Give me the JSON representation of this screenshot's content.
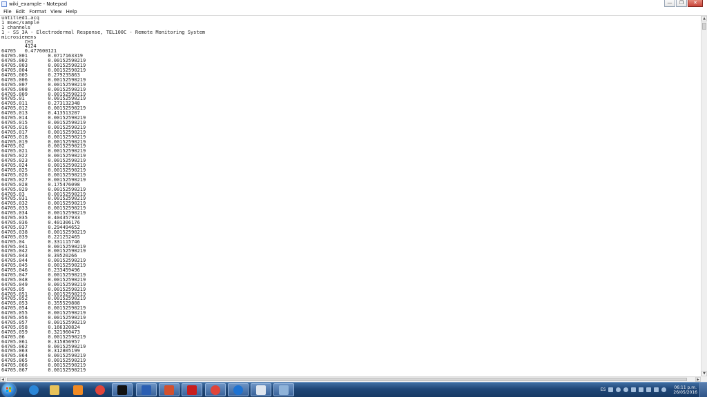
{
  "window": {
    "title": "wiki_example - Notepad",
    "controls": {
      "minimize": "—",
      "maximize": "❐",
      "close": "✕"
    }
  },
  "menubar": {
    "items": [
      "File",
      "Edit",
      "Format",
      "View",
      "Help"
    ]
  },
  "document": {
    "lines": [
      "untitled1.acq",
      "1 msec/sample",
      "1 channels",
      "1 - SS 3A - Electrodermal Response, TEL100C - Remote Monitoring System",
      "microsiemens",
      "        CH1",
      "        4124",
      "64705   0.477600121",
      "64705.001       0.0717163319",
      "64705.002       0.00152590219",
      "64705.003       0.00152590219",
      "64705.004       0.00152590219",
      "64705.005       0.279235863",
      "64705.006       0.00152590219",
      "64705.007       0.00152590219",
      "64705.008       0.00152590219",
      "64705.009       0.00152590219",
      "64705.01        0.00152590219",
      "64705.011       0.273132348",
      "64705.012       0.00152590219",
      "64705.013       0.413513207",
      "64705.014       0.00152590219",
      "64705.015       0.00152590219",
      "64705.016       0.00152590219",
      "64705.017       0.00152590219",
      "64705.018       0.00152590219",
      "64705.019       0.00152590219",
      "64705.02        0.00152590219",
      "64705.021       0.00152590219",
      "64705.022       0.00152590219",
      "64705.023       0.00152590219",
      "64705.024       0.00152590219",
      "64705.025       0.00152590219",
      "64705.026       0.00152590219",
      "64705.027       0.00152590219",
      "64705.028       0.175476098",
      "64705.029       0.00152590219",
      "64705.03        0.00152590219",
      "64705.031       0.00152590219",
      "64705.032       0.00152590219",
      "64705.033       0.00152590219",
      "64705.034       0.00152590219",
      "64705.035       0.404357933",
      "64705.036       0.401306176",
      "64705.037       0.294494652",
      "64705.038       0.00152590219",
      "64705.039       0.221252465",
      "64705.04        0.331115746",
      "64705.041       0.00152590219",
      "64705.042       0.00152590219",
      "64705.043       0.39520266",
      "64705.044       0.00152590219",
      "64705.045       0.00152590219",
      "64705.046       0.233459496",
      "64705.047       0.00152590219",
      "64705.048       0.00152590219",
      "64705.049       0.00152590219",
      "64705.05        0.00152590219",
      "64705.051       0.00152590219",
      "64705.052       0.00152590219",
      "64705.053       0.355529808",
      "64705.054       0.00152590219",
      "64705.055       0.00152590219",
      "64705.056       0.00152590219",
      "64705.057       0.00152590219",
      "64705.058       0.166320824",
      "64705.059       0.321960473",
      "64705.06        0.00152590219",
      "64705.061       0.315856957",
      "64705.062       0.00152590219",
      "64705.063       0.312805199",
      "64705.064       0.00152590219",
      "64705.065       0.00152590219",
      "64705.066       0.00152590219",
      "64705.067       0.00152590219"
    ]
  },
  "taskbar": {
    "pinned": [
      {
        "name": "internet-explorer-icon",
        "color": "#2a86d8"
      },
      {
        "name": "file-explorer-icon",
        "color": "#e7c25a"
      },
      {
        "name": "media-player-icon",
        "color": "#f08a24"
      },
      {
        "name": "chrome-icon",
        "color": "#e0443a"
      },
      {
        "name": "command-prompt-icon",
        "color": "#111111"
      },
      {
        "name": "word-icon",
        "color": "#2b5fb3"
      },
      {
        "name": "powerpoint-icon",
        "color": "#d2502e"
      },
      {
        "name": "acrobat-icon",
        "color": "#c81e1e"
      },
      {
        "name": "chrome-icon-2",
        "color": "#e0443a"
      },
      {
        "name": "teamviewer-icon",
        "color": "#1e73d2"
      },
      {
        "name": "notepad-icon",
        "color": "#dfe6ef"
      },
      {
        "name": "generic-app-icon",
        "color": "#8fb3d9"
      }
    ],
    "tray": {
      "language": "ES",
      "time": "06:11 p.m.",
      "date": "26/05/2016"
    }
  },
  "colors": {
    "taskbar": "#1f4677",
    "close_button": "#c9453a"
  }
}
